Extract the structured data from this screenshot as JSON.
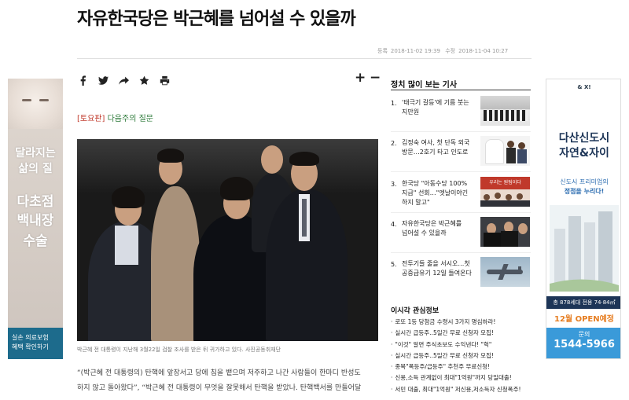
{
  "article": {
    "headline": "자유한국당은 박근혜를 넘어설 수 있을까",
    "registered_label": "등록",
    "registered_time": "2018-11-02 19:39",
    "modified_label": "수정",
    "modified_time": "2018-11-04 10:27",
    "section_tag": "[토요판]",
    "section_name": "다음주의 질문",
    "photo_caption": "박근혜 전 대통령이 지난해 3월22일 검찰 조사를 받은 뒤 귀가하고 있다. 사진공동취재단",
    "body_lines": [
      "“(박근혜 전 대통령의) 탄핵에 앞장서고 당에 침을 뱉으며 저주하고 나간 사람들이 한마디 반성도",
      "하지 않고 돌아왔다”, “박근혜 전 대통령이 무엇을 잘못해서 탄핵을 받았나. 탄핵백서를 만들어달"
    ]
  },
  "toolbar": {
    "font_increase": "+",
    "font_decrease": "−"
  },
  "popular": {
    "title": "정치 많이 보는 기사",
    "items": [
      {
        "rank": "1.",
        "title": "'태극기 갈등'에 기름 붓는 지만원"
      },
      {
        "rank": "2.",
        "title": "김정숙 여사, 첫 단독 외국 방문…2호기 타고 인도로"
      },
      {
        "rank": "3.",
        "title": "한국당 \"아동수당 100% 지급\" 선회…\"엣날이야긴 하지 말고\""
      },
      {
        "rank": "4.",
        "title": "자유한국당은 박근혜를 넘어설 수 있을까"
      },
      {
        "rank": "5.",
        "title": "전투기들 줄을 서시오…첫 공중급유기 12일 들여온다"
      }
    ],
    "thumb3_sign": "우리는 원팀이다"
  },
  "issues": {
    "title": "이시각 관심정보",
    "items": [
      "로또 1등 당첨금 수령시 3가지 명심하라!",
      "실시간 급등주..5일간 무료 신청자 모집!",
      "\"이것\" 알면 주식초보도 수익낸다! \"헉\"",
      "실시간 급등주..5일간 무료 신청자 모집!",
      "종목\"폭등주/급등주\" 추천주 무료신청!",
      "신용,소득 관계없이 최대\"1억원\"까지 당일대출!",
      "서민 대출, 최대\"1억원\" 저신용,저소득자 신청폭주!"
    ]
  },
  "ad_left": {
    "line1": "달라지는",
    "line2": "삶의 질",
    "line3": "다초점",
    "line4": "백내장",
    "line5": "수술",
    "footer1": "실손 의료보험",
    "footer2": "혜택 확인하기"
  },
  "ad_right": {
    "logo": "&  X!",
    "title1": "다산신도시",
    "title2": "자연&자이",
    "sub1": "신도시 프리미엄의",
    "sub2": "정점을 누리다!",
    "units": "총 878세대 전용 74·84㎡",
    "open": "12월 OPEN예정",
    "call_label": "문의",
    "phone": "1544-5966"
  },
  "colors": {
    "tag_red": "#c0392b",
    "section_green": "#2d7a3a",
    "ad_blue": "#1d6b8c",
    "ad_navy": "#1d3557",
    "ad_sky": "#3a9ad9",
    "ad_orange": "#e67e22"
  },
  "icons": [
    "facebook-icon",
    "twitter-icon",
    "share-icon",
    "star-icon",
    "print-icon"
  ]
}
